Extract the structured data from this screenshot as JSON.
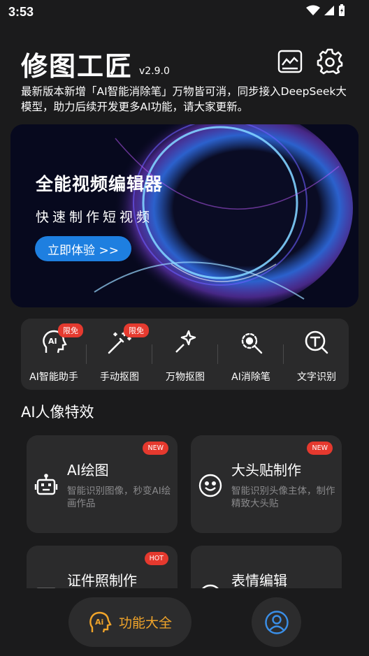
{
  "status_bar": {
    "time": "3:53"
  },
  "header": {
    "app_title": "修图工匠",
    "version": "v2.9.0",
    "announcement": "最新版本新增「AI智能消除笔」万物皆可消，同步接入DeepSeek大模型，助力后续开发更多AI功能，请大家更新。",
    "icons": [
      "stats-icon",
      "gear-icon"
    ]
  },
  "banner": {
    "title": "全能视频编辑器",
    "subtitle": "快速制作短视频",
    "button": "立即体验 >>"
  },
  "tools": [
    {
      "label": "AI智能助手",
      "badge": "限免",
      "icon": "ai-head-icon"
    },
    {
      "label": "手动抠图",
      "badge": "限免",
      "icon": "magic-wand-icon"
    },
    {
      "label": "万物抠图",
      "badge": "",
      "icon": "wand-icon"
    },
    {
      "label": "AI消除笔",
      "badge": "",
      "icon": "eraser-icon"
    },
    {
      "label": "文字识别",
      "badge": "",
      "icon": "text-recognition-icon"
    }
  ],
  "section": {
    "title": "AI人像特效"
  },
  "cards": [
    {
      "title": "AI绘图",
      "desc": "智能识别图像，秒变AI绘画作品",
      "badge": "NEW",
      "icon": "robot-icon"
    },
    {
      "title": "大头贴制作",
      "desc": "智能识别头像主体，制作精致大头贴",
      "badge": "NEW",
      "icon": "smiley-icon"
    },
    {
      "title": "证件照制作",
      "desc": "",
      "badge": "HOT",
      "icon": "id-card-icon"
    },
    {
      "title": "表情编辑",
      "desc": "",
      "badge": "",
      "icon": "emoji-icon"
    }
  ],
  "bottom_nav": {
    "all_features": "功能大全",
    "accent_color": "#f0a42a",
    "profile_color": "#3a8fe8"
  }
}
